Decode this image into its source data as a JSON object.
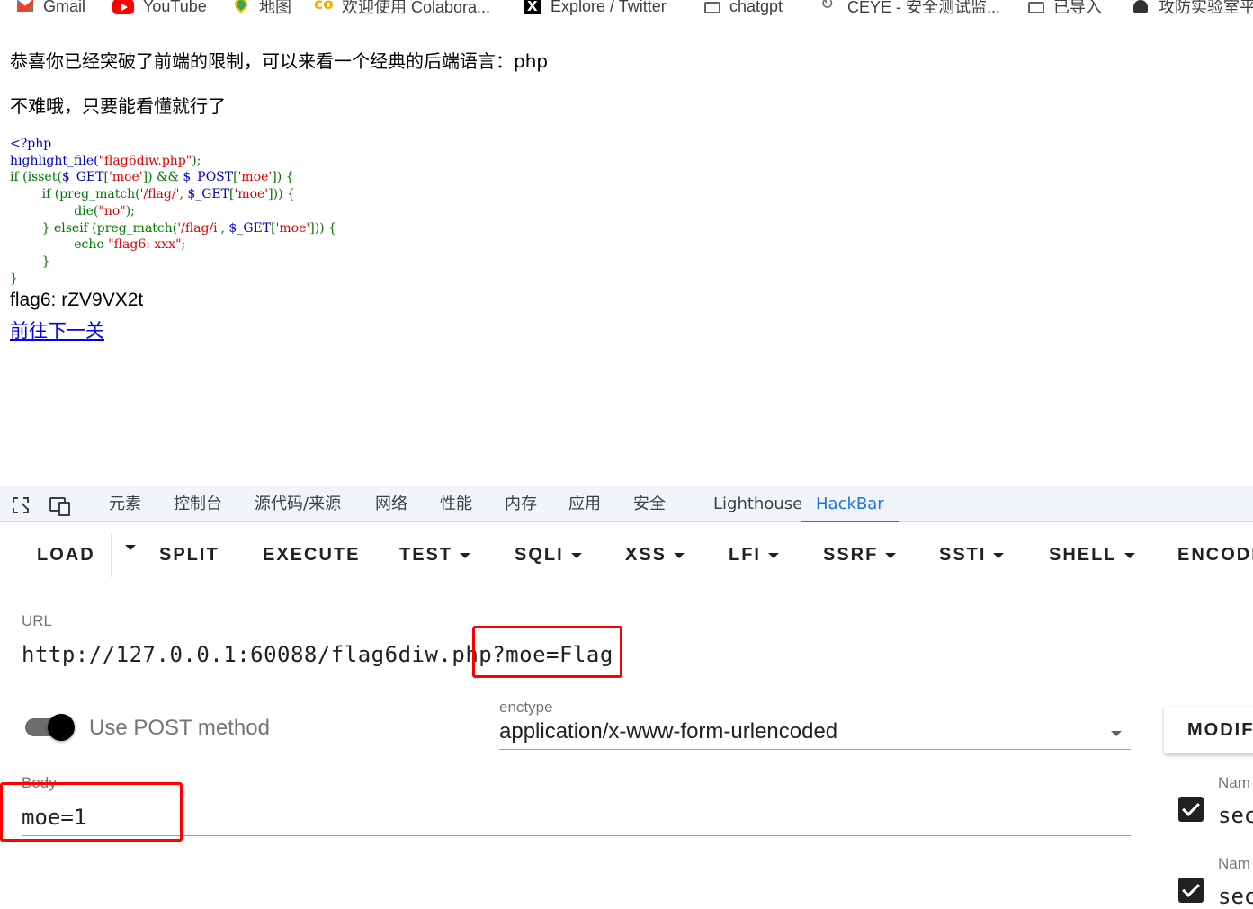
{
  "bookmarks": [
    {
      "label": "Gmail",
      "icon": "gmail-icon"
    },
    {
      "label": "YouTube",
      "icon": "youtube-icon"
    },
    {
      "label": "地图",
      "icon": "maps-icon"
    },
    {
      "label": "欢迎使用 Colabora...",
      "icon": "colab-icon"
    },
    {
      "label": "Explore / Twitter",
      "icon": "x-icon"
    },
    {
      "label": "chatgpt",
      "icon": "folder-icon"
    },
    {
      "label": "CEYE - 安全测试监...",
      "icon": "ceye-icon"
    },
    {
      "label": "已导入",
      "icon": "folder-icon"
    },
    {
      "label": "攻防实验室平",
      "icon": "hat-icon"
    }
  ],
  "page": {
    "line1": "恭喜你已经突破了前端的限制，可以来看一个经典的后端语言：php",
    "line2": "不难哦，只要能看懂就行了",
    "code": {
      "l1": "<?php",
      "l2a": "highlight_file(",
      "l2b": "\"flag6diw.php\"",
      "l2c": ");",
      "l3a": "if",
      "l3b": " (isset(",
      "l3c": "$_GET",
      "l3d": "[",
      "l3e": "'moe'",
      "l3f": "]) && ",
      "l3g": "$_POST",
      "l3h": "[",
      "l3i": "'moe'",
      "l3j": "]) {",
      "l4a": "        if",
      "l4b": " (preg_match(",
      "l4c": "'/flag/'",
      "l4d": ", ",
      "l4e": "$_GET",
      "l4f": "[",
      "l4g": "'moe'",
      "l4h": "])) {",
      "l5a": "                die(",
      "l5b": "\"no\"",
      "l5c": ");",
      "l6a": "        } elseif",
      "l6b": " (preg_match(",
      "l6c": "'/flag/i'",
      "l6d": ", ",
      "l6e": "$_GET",
      "l6f": "[",
      "l6g": "'moe'",
      "l6h": "])) {",
      "l7a": "                echo ",
      "l7b": "\"flag6: xxx\"",
      "l7c": ";",
      "l8": "        }",
      "l9": "}"
    },
    "flag_output": "flag6: rZV9VX2t",
    "next_link": "前往下一关"
  },
  "devtools": {
    "tabs": [
      "元素",
      "控制台",
      "源代码/来源",
      "网络",
      "性能",
      "内存",
      "应用",
      "安全",
      "Lighthouse",
      "HackBar"
    ],
    "active_tab": "HackBar"
  },
  "hackbar": {
    "buttons": [
      "LOAD",
      "SPLIT",
      "EXECUTE",
      "TEST",
      "SQLI",
      "XSS",
      "LFI",
      "SSRF",
      "SSTI",
      "SHELL",
      "ENCODI"
    ],
    "url_label": "URL",
    "url_value": "http://127.0.0.1:60088/flag6diw.php?moe=Flag",
    "post_label": "Use POST method",
    "post_enabled": true,
    "enctype_label": "enctype",
    "enctype_value": "application/x-www-form-urlencoded",
    "modify_label": "MODIF",
    "body_label": "Body",
    "body_value": "moe=1",
    "headers": [
      {
        "label": "Nam",
        "value": "sec",
        "checked": true
      },
      {
        "label": "Nam",
        "value": "sec",
        "checked": true
      }
    ],
    "highlight_color": "#ff0000"
  }
}
